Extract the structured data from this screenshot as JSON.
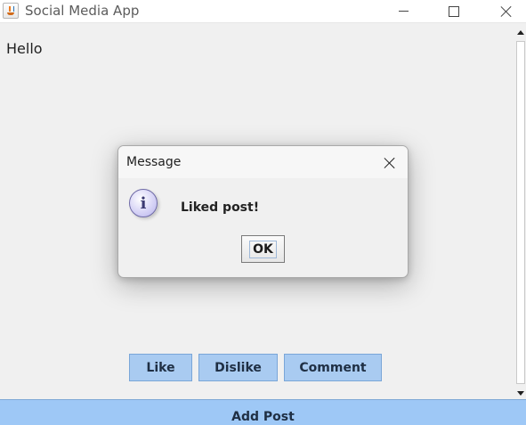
{
  "window": {
    "title": "Social Media App"
  },
  "content": {
    "post_text": "Hello"
  },
  "actions": {
    "like_label": "Like",
    "dislike_label": "Dislike",
    "comment_label": "Comment",
    "add_post_label": "Add Post"
  },
  "dialog": {
    "title": "Message",
    "message": "Liked post!",
    "ok_label": "OK",
    "icon_glyph": "i"
  },
  "icons": {
    "app": "java-icon",
    "minimize": "minimize-icon",
    "maximize": "maximize-icon",
    "close": "close-icon",
    "info": "info-icon"
  },
  "colors": {
    "button_fill": "#a9cbf1",
    "add_post_fill": "#9ec8f6",
    "window_bg": "#f0f0f0"
  }
}
